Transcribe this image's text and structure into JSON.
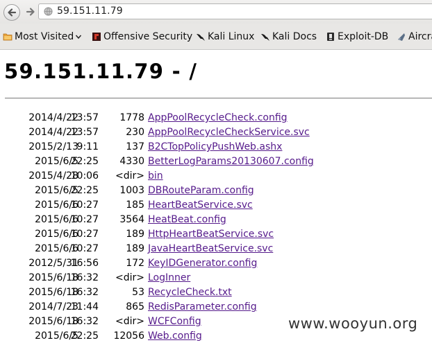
{
  "toolbar": {
    "url": "59.151.11.79"
  },
  "bookmarks": [
    {
      "label": "Most Visited",
      "icon": "folder-icon",
      "has_dropdown": true
    },
    {
      "label": "Offensive Security",
      "icon": "offsec-logo-icon"
    },
    {
      "label": "Kali Linux",
      "icon": "kali-dragon-icon"
    },
    {
      "label": "Kali Docs",
      "icon": "kali-dragon-icon"
    },
    {
      "label": "Exploit-DB",
      "icon": "exploitdb-icon"
    },
    {
      "label": "Aircra",
      "icon": "aircrack-icon"
    }
  ],
  "page": {
    "title": "59.151.11.79 - /"
  },
  "entries": [
    {
      "date": "2014/4/22",
      "time": "13:57",
      "size": "1778",
      "name": "AppPoolRecycleCheck.config"
    },
    {
      "date": "2014/4/22",
      "time": "13:57",
      "size": "230",
      "name": "AppPoolRecycleCheckService.svc"
    },
    {
      "date": "2015/2/13",
      "time": "9:11",
      "size": "137",
      "name": "B2CTopPolicyPushWeb.ashx"
    },
    {
      "date": "2015/6/5",
      "time": "22:25",
      "size": "4330",
      "name": "BetterLogParams20130607.config"
    },
    {
      "date": "2015/4/28",
      "time": "10:06",
      "size": "<dir>",
      "name": "bin"
    },
    {
      "date": "2015/6/5",
      "time": "22:25",
      "size": "1003",
      "name": "DBRouteParam.config"
    },
    {
      "date": "2015/6/6",
      "time": "10:27",
      "size": "185",
      "name": "HeartBeatService.svc"
    },
    {
      "date": "2015/6/6",
      "time": "10:27",
      "size": "3564",
      "name": "HeatBeat.config"
    },
    {
      "date": "2015/6/6",
      "time": "10:27",
      "size": "189",
      "name": "HttpHeartBeatService.svc"
    },
    {
      "date": "2015/6/6",
      "time": "10:27",
      "size": "189",
      "name": "JavaHeartBeatService.svc"
    },
    {
      "date": "2012/5/31",
      "time": "16:56",
      "size": "172",
      "name": "KeyIDGenerator.config"
    },
    {
      "date": "2015/6/18",
      "time": "16:32",
      "size": "<dir>",
      "name": "LogInner"
    },
    {
      "date": "2015/6/18",
      "time": "16:32",
      "size": "53",
      "name": "RecycleCheck.txt"
    },
    {
      "date": "2014/7/23",
      "time": "11:44",
      "size": "865",
      "name": "RedisParameter.config"
    },
    {
      "date": "2015/6/18",
      "time": "16:32",
      "size": "<dir>",
      "name": "WCFConfig"
    },
    {
      "date": "2015/6/5",
      "time": "22:25",
      "size": "12056",
      "name": "Web.config"
    }
  ],
  "watermark": "www.wooyun.org",
  "colors": {
    "link": "#551a8b",
    "toolbar_bg": "#e8e7e5"
  }
}
